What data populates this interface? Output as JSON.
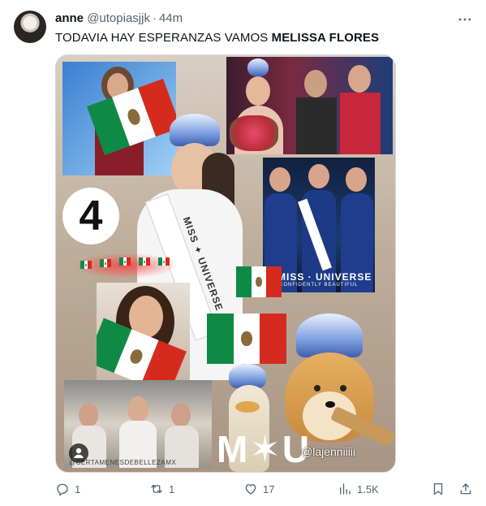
{
  "author": {
    "name": "anne",
    "handle": "@utopiasjjk",
    "separator": "·",
    "time": "44m"
  },
  "tweet": {
    "text_plain": "TODAVIA HAY ESPERANZAS VAMOS ",
    "text_bold": "MELISSA FLORES"
  },
  "media": {
    "badge_number": "4",
    "sash_text": "MISS ✦ UNIVERSE",
    "sash_text_2": "MISS ✦ UNIVERSE",
    "tile_banner": "MISS · UNIVERSE",
    "tile_tagline": "CONFIDENTLY BEAUTIFUL",
    "mu_logo": "M✶U",
    "tiktok_handle": "@lajenniiiii",
    "watermark": "@CERTAMENESDEBELLEZAMX"
  },
  "actions": {
    "replies": "1",
    "reposts": "1",
    "likes": "17",
    "views": "1.5K"
  },
  "icons": {
    "more": "more-horizontal-icon",
    "reply": "reply-icon",
    "repost": "repost-icon",
    "like": "heart-icon",
    "views": "views-icon",
    "bookmark": "bookmark-icon",
    "share": "share-icon"
  }
}
